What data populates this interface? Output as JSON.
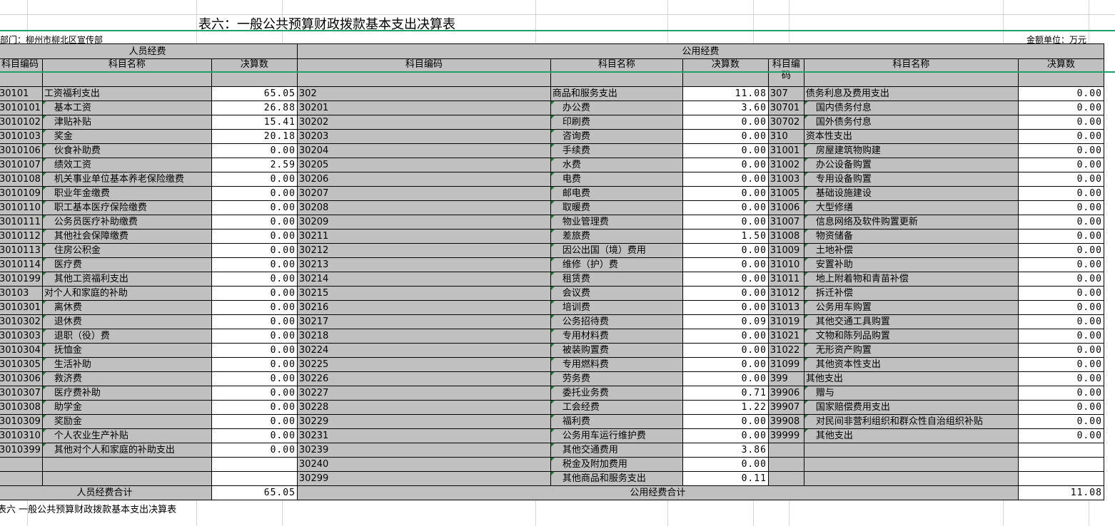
{
  "title": "表六：一般公共预算财政拨款基本支出决算表",
  "dept_label": "部门：柳州市柳北区宣传部",
  "unit_label": "金额单位：万元",
  "headers": {
    "personnel": "人员经费",
    "public": "公用经费",
    "code": "科目编码",
    "name": "科目名称",
    "amount": "决算数"
  },
  "rows": [
    {
      "c1": "30101",
      "n1": "工资福利支出",
      "a1": "65.05",
      "c2": "302",
      "n2": "商品和服务支出",
      "a2": "11.08",
      "c3": "307",
      "n3": "债务利息及费用支出",
      "a3": "0.00",
      "l1": 0,
      "l2": 0,
      "l3": 0
    },
    {
      "c1": "3010101",
      "n1": "基本工资",
      "a1": "26.88",
      "c2": "30201",
      "n2": "办公费",
      "a2": "3.60",
      "c3": "30701",
      "n3": "国内债务付息",
      "a3": "0.00",
      "l1": 1,
      "l2": 1,
      "l3": 1
    },
    {
      "c1": "3010102",
      "n1": "津贴补贴",
      "a1": "15.41",
      "c2": "30202",
      "n2": "印刷费",
      "a2": "0.00",
      "c3": "30702",
      "n3": "国外债务付息",
      "a3": "0.00",
      "l1": 1,
      "l2": 1,
      "l3": 1
    },
    {
      "c1": "3010103",
      "n1": "奖金",
      "a1": "20.18",
      "c2": "30203",
      "n2": "咨询费",
      "a2": "0.00",
      "c3": "310",
      "n3": "资本性支出",
      "a3": "0.00",
      "l1": 1,
      "l2": 1,
      "l3": 0
    },
    {
      "c1": "3010106",
      "n1": "伙食补助费",
      "a1": "0.00",
      "c2": "30204",
      "n2": "手续费",
      "a2": "0.00",
      "c3": "31001",
      "n3": "房屋建筑物购建",
      "a3": "0.00",
      "l1": 1,
      "l2": 1,
      "l3": 1
    },
    {
      "c1": "3010107",
      "n1": "绩效工资",
      "a1": "2.59",
      "c2": "30205",
      "n2": "水费",
      "a2": "0.00",
      "c3": "31002",
      "n3": "办公设备购置",
      "a3": "0.00",
      "l1": 1,
      "l2": 1,
      "l3": 1
    },
    {
      "c1": "3010108",
      "n1": "机关事业单位基本养老保险缴费",
      "a1": "0.00",
      "c2": "30206",
      "n2": "电费",
      "a2": "0.00",
      "c3": "31003",
      "n3": "专用设备购置",
      "a3": "0.00",
      "l1": 1,
      "l2": 1,
      "l3": 1
    },
    {
      "c1": "3010109",
      "n1": "职业年金缴费",
      "a1": "0.00",
      "c2": "30207",
      "n2": "邮电费",
      "a2": "0.00",
      "c3": "31005",
      "n3": "基础设施建设",
      "a3": "0.00",
      "l1": 1,
      "l2": 1,
      "l3": 1
    },
    {
      "c1": "3010110",
      "n1": "职工基本医疗保险缴费",
      "a1": "0.00",
      "c2": "30208",
      "n2": "取暖费",
      "a2": "0.00",
      "c3": "31006",
      "n3": "大型修缮",
      "a3": "0.00",
      "l1": 1,
      "l2": 1,
      "l3": 1
    },
    {
      "c1": "3010111",
      "n1": "公务员医疗补助缴费",
      "a1": "0.00",
      "c2": "30209",
      "n2": "物业管理费",
      "a2": "0.00",
      "c3": "31007",
      "n3": "信息网络及软件购置更新",
      "a3": "0.00",
      "l1": 1,
      "l2": 1,
      "l3": 1
    },
    {
      "c1": "3010112",
      "n1": "其他社会保障缴费",
      "a1": "0.00",
      "c2": "30211",
      "n2": "差旅费",
      "a2": "1.50",
      "c3": "31008",
      "n3": "物资储备",
      "a3": "0.00",
      "l1": 1,
      "l2": 1,
      "l3": 1
    },
    {
      "c1": "3010113",
      "n1": "住房公积金",
      "a1": "0.00",
      "c2": "30212",
      "n2": "因公出国（境）费用",
      "a2": "0.00",
      "c3": "31009",
      "n3": "土地补偿",
      "a3": "0.00",
      "l1": 1,
      "l2": 1,
      "l3": 1
    },
    {
      "c1": "3010114",
      "n1": "医疗费",
      "a1": "0.00",
      "c2": "30213",
      "n2": "维修（护）费",
      "a2": "0.00",
      "c3": "31010",
      "n3": "安置补助",
      "a3": "0.00",
      "l1": 1,
      "l2": 1,
      "l3": 1
    },
    {
      "c1": "3010199",
      "n1": "其他工资福利支出",
      "a1": "0.00",
      "c2": "30214",
      "n2": "租赁费",
      "a2": "0.00",
      "c3": "31011",
      "n3": "地上附着物和青苗补偿",
      "a3": "0.00",
      "l1": 1,
      "l2": 1,
      "l3": 1
    },
    {
      "c1": "30103",
      "n1": "对个人和家庭的补助",
      "a1": "0.00",
      "c2": "30215",
      "n2": "会议费",
      "a2": "0.00",
      "c3": "31012",
      "n3": "拆迁补偿",
      "a3": "0.00",
      "l1": 0,
      "l2": 1,
      "l3": 1
    },
    {
      "c1": "3010301",
      "n1": "离休费",
      "a1": "0.00",
      "c2": "30216",
      "n2": "培训费",
      "a2": "0.00",
      "c3": "31013",
      "n3": "公务用车购置",
      "a3": "0.00",
      "l1": 1,
      "l2": 1,
      "l3": 1
    },
    {
      "c1": "3010302",
      "n1": "退休费",
      "a1": "0.00",
      "c2": "30217",
      "n2": "公务招待费",
      "a2": "0.09",
      "c3": "31019",
      "n3": "其他交通工具购置",
      "a3": "0.00",
      "l1": 1,
      "l2": 1,
      "l3": 1
    },
    {
      "c1": "3010303",
      "n1": "退职（役）费",
      "a1": "0.00",
      "c2": "30218",
      "n2": "专用材料费",
      "a2": "0.00",
      "c3": "31021",
      "n3": "文物和陈列品购置",
      "a3": "0.00",
      "l1": 1,
      "l2": 1,
      "l3": 1
    },
    {
      "c1": "3010304",
      "n1": "抚恤金",
      "a1": "0.00",
      "c2": "30224",
      "n2": "被装购置费",
      "a2": "0.00",
      "c3": "31022",
      "n3": "无形资产购置",
      "a3": "0.00",
      "l1": 1,
      "l2": 1,
      "l3": 1
    },
    {
      "c1": "3010305",
      "n1": "生活补助",
      "a1": "0.00",
      "c2": "30225",
      "n2": "专用燃料费",
      "a2": "0.00",
      "c3": "31099",
      "n3": "其他资本性支出",
      "a3": "0.00",
      "l1": 1,
      "l2": 1,
      "l3": 1
    },
    {
      "c1": "3010306",
      "n1": "救济费",
      "a1": "0.00",
      "c2": "30226",
      "n2": "劳务费",
      "a2": "0.00",
      "c3": "399",
      "n3": "其他支出",
      "a3": "0.00",
      "l1": 1,
      "l2": 1,
      "l3": 0
    },
    {
      "c1": "3010307",
      "n1": "医疗费补助",
      "a1": "0.00",
      "c2": "30227",
      "n2": "委托业务费",
      "a2": "0.71",
      "c3": "39906",
      "n3": "赠与",
      "a3": "0.00",
      "l1": 1,
      "l2": 1,
      "l3": 1
    },
    {
      "c1": "3010308",
      "n1": "助学金",
      "a1": "0.00",
      "c2": "30228",
      "n2": "工会经费",
      "a2": "1.22",
      "c3": "39907",
      "n3": "国家赔偿费用支出",
      "a3": "0.00",
      "l1": 1,
      "l2": 1,
      "l3": 1
    },
    {
      "c1": "3010309",
      "n1": "奖励金",
      "a1": "0.00",
      "c2": "30229",
      "n2": "福利费",
      "a2": "0.00",
      "c3": "39908",
      "n3": "对民间非营利组织和群众性自治组织补贴",
      "a3": "0.00",
      "l1": 1,
      "l2": 1,
      "l3": 1
    },
    {
      "c1": "3010310",
      "n1": "个人农业生产补贴",
      "a1": "0.00",
      "c2": "30231",
      "n2": "公务用车运行维护费",
      "a2": "0.00",
      "c3": "39999",
      "n3": "其他支出",
      "a3": "0.00",
      "l1": 1,
      "l2": 1,
      "l3": 1
    },
    {
      "c1": "3010399",
      "n1": "其他对个人和家庭的补助支出",
      "a1": "0.00",
      "c2": "30239",
      "n2": "其他交通费用",
      "a2": "3.86",
      "c3": "",
      "n3": "",
      "a3": "",
      "l1": 1,
      "l2": 1,
      "l3": 0
    },
    {
      "c1": "",
      "n1": "",
      "a1": "",
      "c2": "30240",
      "n2": "税金及附加费用",
      "a2": "0.00",
      "c3": "",
      "n3": "",
      "a3": "",
      "l1": 0,
      "l2": 1,
      "l3": 0
    },
    {
      "c1": "",
      "n1": "",
      "a1": "",
      "c2": "30299",
      "n2": "其他商品和服务支出",
      "a2": "0.11",
      "c3": "",
      "n3": "",
      "a3": "",
      "l1": 0,
      "l2": 1,
      "l3": 0
    }
  ],
  "totals": {
    "personnel_label": "人员经费合计",
    "personnel_value": "65.05",
    "public_label": "公用经费合计",
    "public_value": "11.08"
  },
  "footer": "表六 一般公共预算财政拨款基本支出决算表"
}
